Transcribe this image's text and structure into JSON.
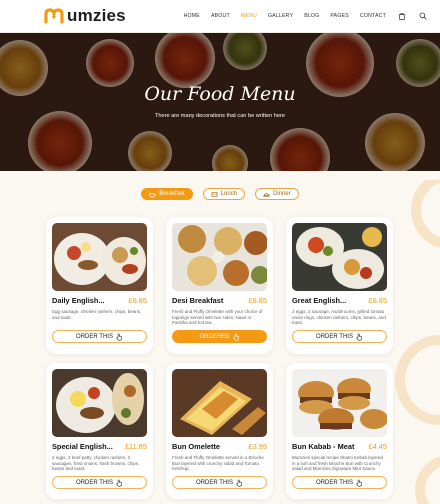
{
  "brand": {
    "name": "umzies",
    "accent": "#f39a12"
  },
  "nav": {
    "items": [
      {
        "label": "HOME",
        "active": false
      },
      {
        "label": "ABOUT",
        "active": false
      },
      {
        "label": "MENU",
        "active": true
      },
      {
        "label": "GALLERY",
        "active": false
      },
      {
        "label": "BLOG",
        "active": false
      },
      {
        "label": "PAGES",
        "active": false
      },
      {
        "label": "CONTACT",
        "active": false
      }
    ],
    "cart_icon": "shopping-bag-icon",
    "search_icon": "search-icon"
  },
  "hero": {
    "title": "Our Food Menu",
    "subtitle": "There are many decorations that can be written here"
  },
  "tabs": [
    {
      "label": "Breakfast",
      "icon": "breakfast-icon",
      "active": true
    },
    {
      "label": "Lunch",
      "icon": "lunch-icon",
      "active": false
    },
    {
      "label": "Dinner",
      "icon": "dinner-icon",
      "active": false
    }
  ],
  "cards": [
    {
      "name": "Daily English...",
      "price": "£6.85",
      "desc": "Egg sausage, chicken rashers, chips, beans, and toast.",
      "button": "ORDER THIS",
      "ordered": false
    },
    {
      "name": "Desi Breakfast",
      "price": "£8.85",
      "desc": "Fresh and Fluffy Omelette with your choice of toppings served with two sides, Naan or Paratha and hot tea.",
      "button": "ORDERED",
      "ordered": true
    },
    {
      "name": "Great English...",
      "price": "£8.85",
      "desc": "2 eggs, 2 sausage, mushrooms, grilled tomato onion rings, chicken rashers, chips, beans, and toast.",
      "button": "ORDER THIS",
      "ordered": false
    },
    {
      "name": "Special English...",
      "price": "£11.85",
      "desc": "2 eggs, 2 beef patty, chicken rashers, 2 sausages, fried onions, hash browns, chips, beans and toast.",
      "button": "ORDER THIS",
      "ordered": false
    },
    {
      "name": "Bun Omelette",
      "price": "£3.95",
      "desc": "Fresh and Fluffy Omelette served in a Brioche Bun layered with crunchy salad and Tomato Ketchup.",
      "button": "ORDER THIS",
      "ordered": false
    },
    {
      "name": "Bun Kabab - Meat",
      "price": "£4.45",
      "desc": "Mumzies special recipe Shami Kebab layered in a soft and fresh Brioche Bun with Crunchy salad and Mumzies Signature Mint Sauce.",
      "button": "ORDER THIS",
      "ordered": false
    }
  ]
}
